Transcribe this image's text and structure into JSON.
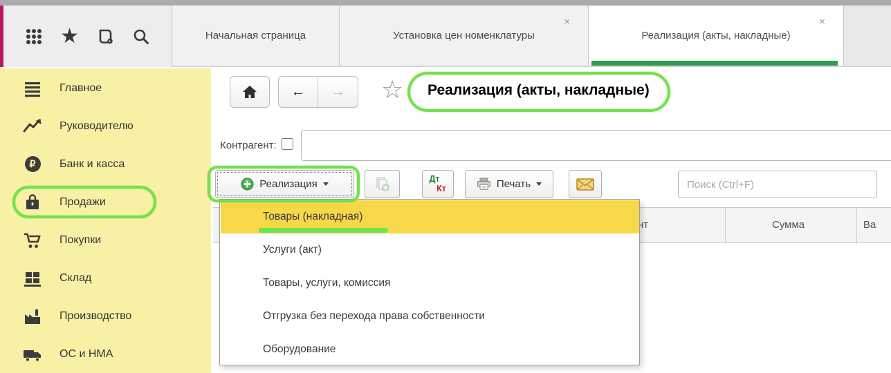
{
  "glyphs": {
    "close": "×",
    "star_filled": "★",
    "star_outline": "☆",
    "arrow_left": "←",
    "arrow_right": "→",
    "ruble": "₽"
  },
  "top_bar": {
    "icons": [
      "apps-grid",
      "favorites-star",
      "history",
      "search"
    ]
  },
  "tabs": [
    {
      "label": "Начальная страница",
      "closable": false,
      "active": false
    },
    {
      "label": "Установка цен номенклатуры",
      "closable": true,
      "active": false
    },
    {
      "label": "Реализация (акты, накладные)",
      "closable": true,
      "active": true
    }
  ],
  "sidebar": {
    "items": [
      {
        "label": "Главное",
        "icon": "menu-lines"
      },
      {
        "label": "Руководителю",
        "icon": "trend-chart"
      },
      {
        "label": "Банк и касса",
        "icon": "ruble-circle"
      },
      {
        "label": "Продажи",
        "icon": "shopping-bag",
        "annotated": true
      },
      {
        "label": "Покупки",
        "icon": "shopping-cart"
      },
      {
        "label": "Склад",
        "icon": "warehouse-boxes"
      },
      {
        "label": "Производство",
        "icon": "factory"
      },
      {
        "label": "ОС и НМА",
        "icon": "truck"
      }
    ]
  },
  "main": {
    "title": "Реализация (акты, накладные)",
    "nav_icons": [
      "home",
      "back",
      "forward",
      "favorite-star"
    ],
    "filter": {
      "label": "Контрагент:",
      "checkbox_checked": false,
      "value": ""
    },
    "toolbar": {
      "create_label": "Реализация",
      "copy_icon": "copy-document-add",
      "dt": "Дт",
      "kt": "Кт",
      "print_label": "Печать",
      "mail_icon": "envelope",
      "search_placeholder": "Поиск (Ctrl+F)",
      "search_value": ""
    },
    "table_headers": [
      {
        "label": "нт"
      },
      {
        "label": "Сумма"
      },
      {
        "label": "Ва"
      }
    ],
    "dropdown_menu": {
      "items": [
        "Товары (накладная)",
        "Услуги (акт)",
        "Товары, услуги, комиссия",
        "Отгрузка без перехода права собственности",
        "Оборудование"
      ],
      "highlighted_index": 0
    }
  },
  "colors": {
    "active_tab_green": "#2f9e4d",
    "annotation_green": "#72e14b",
    "sidebar_yellow": "#f8f0a5",
    "menu_highlight_yellow": "#f6d848",
    "left_stripe_magenta": "#bb1663",
    "dt_green": "#1e7d32",
    "kt_red": "#c62828",
    "envelope_yellow": "#f5d27b"
  }
}
